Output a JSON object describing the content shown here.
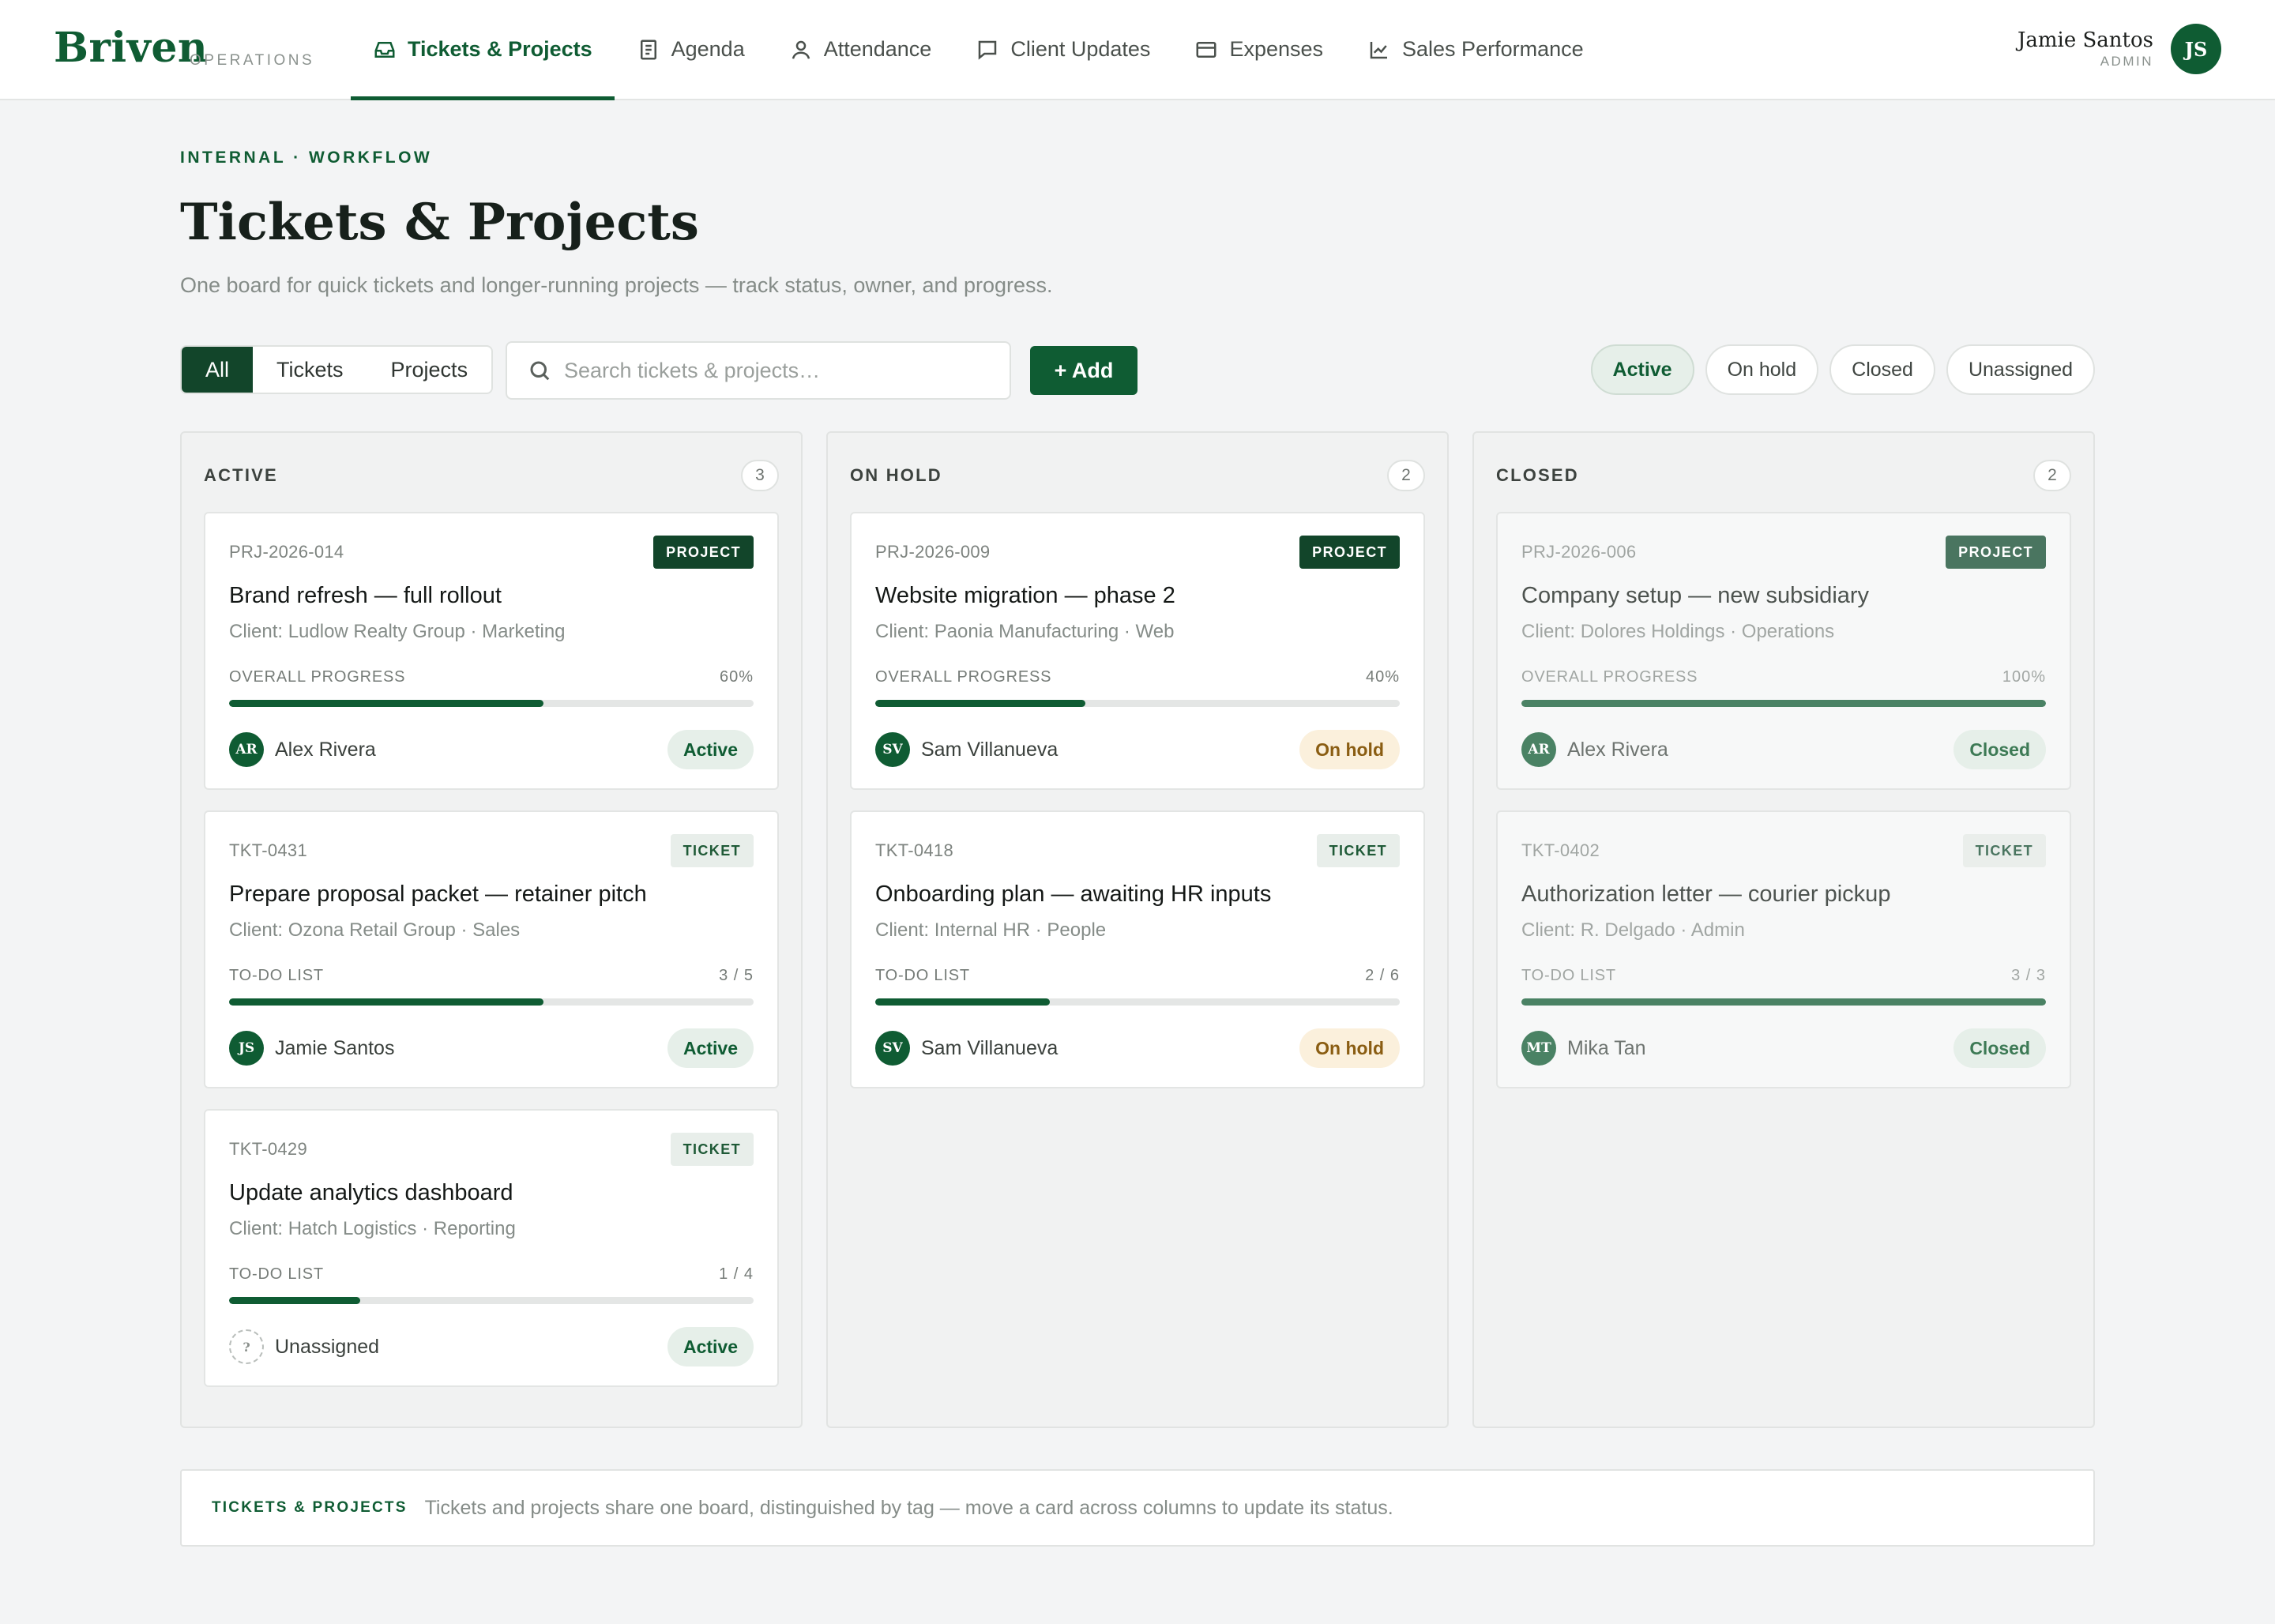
{
  "brand": {
    "name": "Briven",
    "subtitle": "OPERATIONS"
  },
  "nav": [
    {
      "label": "Tickets & Projects",
      "icon": "inbox-icon",
      "active": true
    },
    {
      "label": "Agenda",
      "icon": "document-icon",
      "active": false
    },
    {
      "label": "Attendance",
      "icon": "user-icon",
      "active": false
    },
    {
      "label": "Client Updates",
      "icon": "message-icon",
      "active": false
    },
    {
      "label": "Expenses",
      "icon": "credit-card-icon",
      "active": false
    },
    {
      "label": "Sales Performance",
      "icon": "line-chart-icon",
      "active": false
    }
  ],
  "user": {
    "name": "Jamie Santos",
    "role": "ADMIN",
    "initials": "JS"
  },
  "header": {
    "eyebrow": "INTERNAL · WORKFLOW",
    "title": "Tickets & Projects",
    "subtitle": "One board for quick tickets and longer-running projects — track status, owner, and progress."
  },
  "toolbar": {
    "segments": [
      "All",
      "Tickets",
      "Projects"
    ],
    "active_segment": "All",
    "search_placeholder": "Search tickets & projects…",
    "add_label": "+ Add",
    "filters": [
      "Active",
      "On hold",
      "Closed",
      "Unassigned"
    ],
    "active_filter": "Active"
  },
  "columns": [
    {
      "title": "ACTIVE",
      "count": "3",
      "cards": [
        {
          "id": "PRJ-2026-014",
          "tag": "PROJECT",
          "title": "Brand refresh — full rollout",
          "client": "Client: Ludlow Realty Group · Marketing",
          "progress_label": "OVERALL PROGRESS",
          "progress_value": "60%",
          "progress": 0.6,
          "owner": "Alex Rivera",
          "initials": "AR",
          "status": "Active"
        },
        {
          "id": "TKT-0431",
          "tag": "TICKET",
          "title": "Prepare proposal packet — retainer pitch",
          "client": "Client: Ozona Retail Group · Sales",
          "progress_label": "TO-DO LIST",
          "progress_value": "3 / 5",
          "progress": 0.6,
          "owner": "Jamie Santos",
          "initials": "JS",
          "status": "Active"
        },
        {
          "id": "TKT-0429",
          "tag": "TICKET",
          "title": "Update analytics dashboard",
          "client": "Client: Hatch Logistics · Reporting",
          "progress_label": "TO-DO LIST",
          "progress_value": "1 / 4",
          "progress": 0.25,
          "owner": "Unassigned",
          "initials": "?",
          "status": "Active"
        }
      ]
    },
    {
      "title": "ON HOLD",
      "count": "2",
      "cards": [
        {
          "id": "PRJ-2026-009",
          "tag": "PROJECT",
          "title": "Website migration — phase 2",
          "client": "Client: Paonia Manufacturing · Web",
          "progress_label": "OVERALL PROGRESS",
          "progress_value": "40%",
          "progress": 0.4,
          "owner": "Sam Villanueva",
          "initials": "SV",
          "status": "On hold"
        },
        {
          "id": "TKT-0418",
          "tag": "TICKET",
          "title": "Onboarding plan — awaiting HR inputs",
          "client": "Client: Internal HR · People",
          "progress_label": "TO-DO LIST",
          "progress_value": "2 / 6",
          "progress": 0.3333,
          "owner": "Sam Villanueva",
          "initials": "SV",
          "status": "On hold"
        }
      ]
    },
    {
      "title": "CLOSED",
      "count": "2",
      "cards": [
        {
          "id": "PRJ-2026-006",
          "tag": "PROJECT",
          "title": "Company setup — new subsidiary",
          "client": "Client: Dolores Holdings · Operations",
          "progress_label": "OVERALL PROGRESS",
          "progress_value": "100%",
          "progress": 1.0,
          "owner": "Alex Rivera",
          "initials": "AR",
          "status": "Closed"
        },
        {
          "id": "TKT-0402",
          "tag": "TICKET",
          "title": "Authorization letter — courier pickup",
          "client": "Client: R. Delgado · Admin",
          "progress_label": "TO-DO LIST",
          "progress_value": "3 / 3",
          "progress": 1.0,
          "owner": "Mika Tan",
          "initials": "MT",
          "status": "Closed"
        }
      ]
    }
  ],
  "note": {
    "label": "TICKETS & PROJECTS",
    "text": "Tickets and projects share one board, distinguished by tag — move a card across columns to update its status."
  },
  "colors": {
    "brand": "#0f5c33",
    "hold": "#8a5d12",
    "hold_bg": "#fbf0dc"
  }
}
